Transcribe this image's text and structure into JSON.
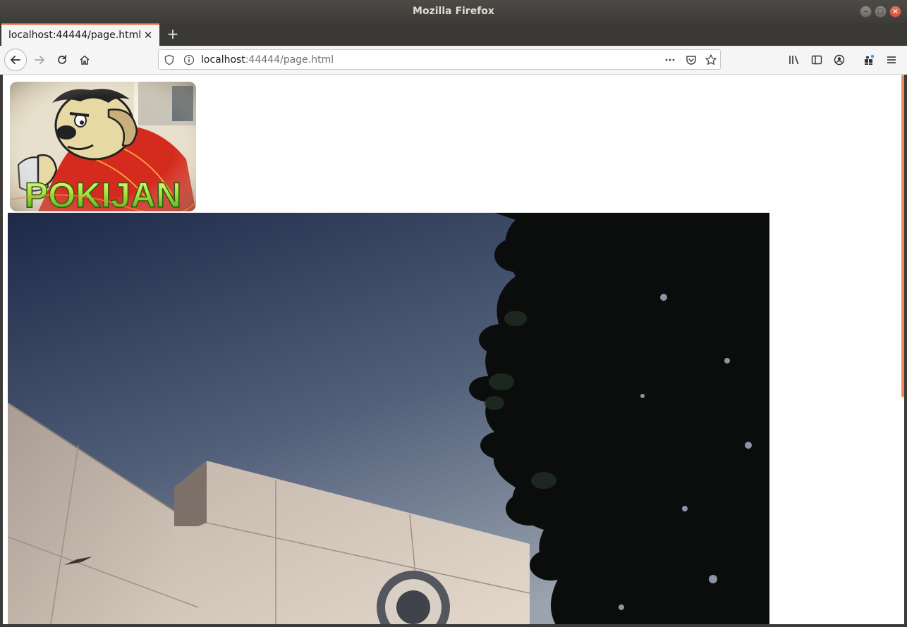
{
  "window": {
    "title": "Mozilla Firefox"
  },
  "tabs": [
    {
      "title": "localhost:44444/page.html",
      "active": true
    }
  ],
  "navbar": {
    "url_host": "localhost",
    "url_rest": ":44444/page.html"
  },
  "page": {
    "logo": {
      "text": "POKIJAN"
    }
  },
  "icons": {
    "back": "arrow-left-icon",
    "forward": "arrow-right-icon",
    "reload": "reload-icon",
    "home": "home-icon",
    "shield": "shield-icon",
    "info": "info-icon",
    "more": "ellipsis-icon",
    "pocket": "pocket-icon",
    "bookmark": "star-icon",
    "library": "library-icon",
    "sidebar": "sidebar-icon",
    "account": "account-icon",
    "extensions": "extensions-icon",
    "menu": "hamburger-menu-icon"
  },
  "colors": {
    "accent": "#e66832",
    "scrollbar": "#f08a5d"
  }
}
